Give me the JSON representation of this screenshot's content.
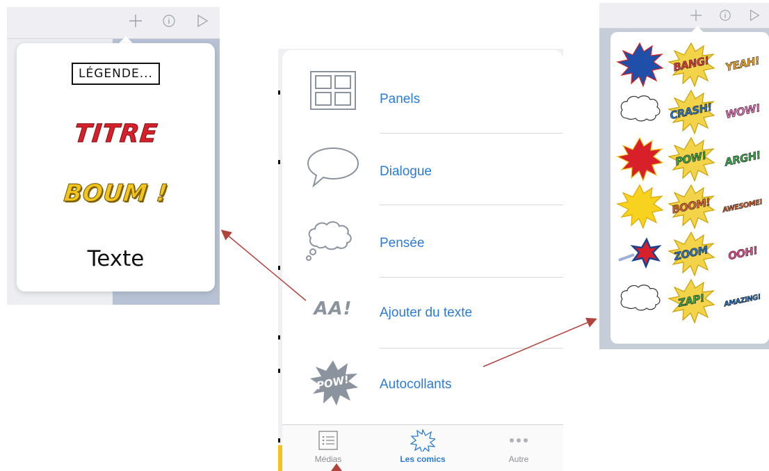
{
  "left_panel": {
    "items": [
      {
        "label": "LÉGENDE...",
        "style": "caption"
      },
      {
        "label": "TITRE",
        "style": "title"
      },
      {
        "label": "BOUM !",
        "style": "boom"
      },
      {
        "label": "Texte",
        "style": "plain"
      }
    ]
  },
  "main_menu": {
    "items": [
      {
        "label": "Panels",
        "icon": "panels-grid-icon"
      },
      {
        "label": "Dialogue",
        "icon": "speech-bubble-icon"
      },
      {
        "label": "Pensée",
        "icon": "thought-bubble-icon"
      },
      {
        "label": "Ajouter du texte",
        "icon": "add-text-icon",
        "icon_text": "AA!"
      },
      {
        "label": "Autocollants",
        "icon": "pow-sticker-icon",
        "icon_text": "POW!"
      }
    ],
    "tabs": [
      {
        "label": "Médias",
        "icon": "list-icon",
        "active": false
      },
      {
        "label": "Les comics",
        "icon": "star-burst-icon",
        "active": true
      },
      {
        "label": "Autre",
        "icon": "more-dots-icon",
        "active": false
      }
    ]
  },
  "stickers": {
    "items": [
      {
        "text": "",
        "kind": "blue-red-burst"
      },
      {
        "text": "BANG!",
        "kind": "text-burst",
        "color": "#e23b3b"
      },
      {
        "text": "YEAH!",
        "kind": "text",
        "color": "#f1a51c"
      },
      {
        "text": "",
        "kind": "cloud"
      },
      {
        "text": "CRASH!",
        "kind": "text-burst",
        "color": "#2a77c8"
      },
      {
        "text": "WOW!",
        "kind": "text",
        "color": "#e26fb3"
      },
      {
        "text": "",
        "kind": "red-burst"
      },
      {
        "text": "POW!",
        "kind": "text-burst",
        "color": "#3aa64a"
      },
      {
        "text": "ARGH!",
        "kind": "text",
        "color": "#3aa64a"
      },
      {
        "text": "",
        "kind": "yellow-burst"
      },
      {
        "text": "BOOM!",
        "kind": "text-burst",
        "color": "#e0662a"
      },
      {
        "text": "AWESOME!",
        "kind": "text",
        "color": "#e0662a"
      },
      {
        "text": "",
        "kind": "flying-star"
      },
      {
        "text": "ZOOM",
        "kind": "text-burst",
        "color": "#2a77c8"
      },
      {
        "text": "OOH!",
        "kind": "text",
        "color": "#e24a8c"
      },
      {
        "text": "",
        "kind": "cloud-burst"
      },
      {
        "text": "ZAP!",
        "kind": "text-burst",
        "color": "#3aa64a"
      },
      {
        "text": "AMAZING!",
        "kind": "text",
        "color": "#2a77c8"
      }
    ]
  },
  "toolbar_icons": [
    "plus-icon",
    "info-icon",
    "play-icon"
  ],
  "colors": {
    "accent": "#2b7bd6",
    "arrow": "#b0443c",
    "icon_gray": "#8a939e"
  }
}
